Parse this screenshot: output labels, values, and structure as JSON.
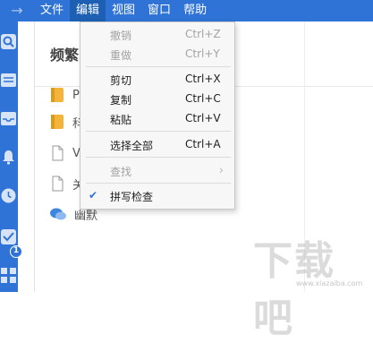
{
  "menubar": {
    "items": [
      "文件",
      "编辑",
      "视图",
      "窗口",
      "帮助"
    ]
  },
  "sidebar": {
    "badge": "1"
  },
  "main": {
    "title": "频繁",
    "rows": [
      {
        "text": "P"
      },
      {
        "text": "科"
      },
      {
        "text": "V"
      },
      {
        "text": "关"
      },
      {
        "text": "幽默"
      }
    ]
  },
  "edit_menu": {
    "undo": {
      "label": "撤销",
      "shortcut": "Ctrl+Z"
    },
    "redo": {
      "label": "重做",
      "shortcut": "Ctrl+Y"
    },
    "cut": {
      "label": "剪切",
      "shortcut": "Ctrl+X"
    },
    "copy": {
      "label": "复制",
      "shortcut": "Ctrl+C"
    },
    "paste": {
      "label": "粘贴",
      "shortcut": "Ctrl+V"
    },
    "select_all": {
      "label": "选择全部",
      "shortcut": "Ctrl+A"
    },
    "find": {
      "label": "查找"
    },
    "spellcheck": {
      "label": "拼写检查",
      "checked": true
    }
  },
  "watermark": {
    "text": "下载吧",
    "sub": "www.xiazaiba.com"
  },
  "colors": {
    "accent": "#2f73d6",
    "menu_bg": "#f7f7f7",
    "disabled": "#a3a3a3"
  }
}
